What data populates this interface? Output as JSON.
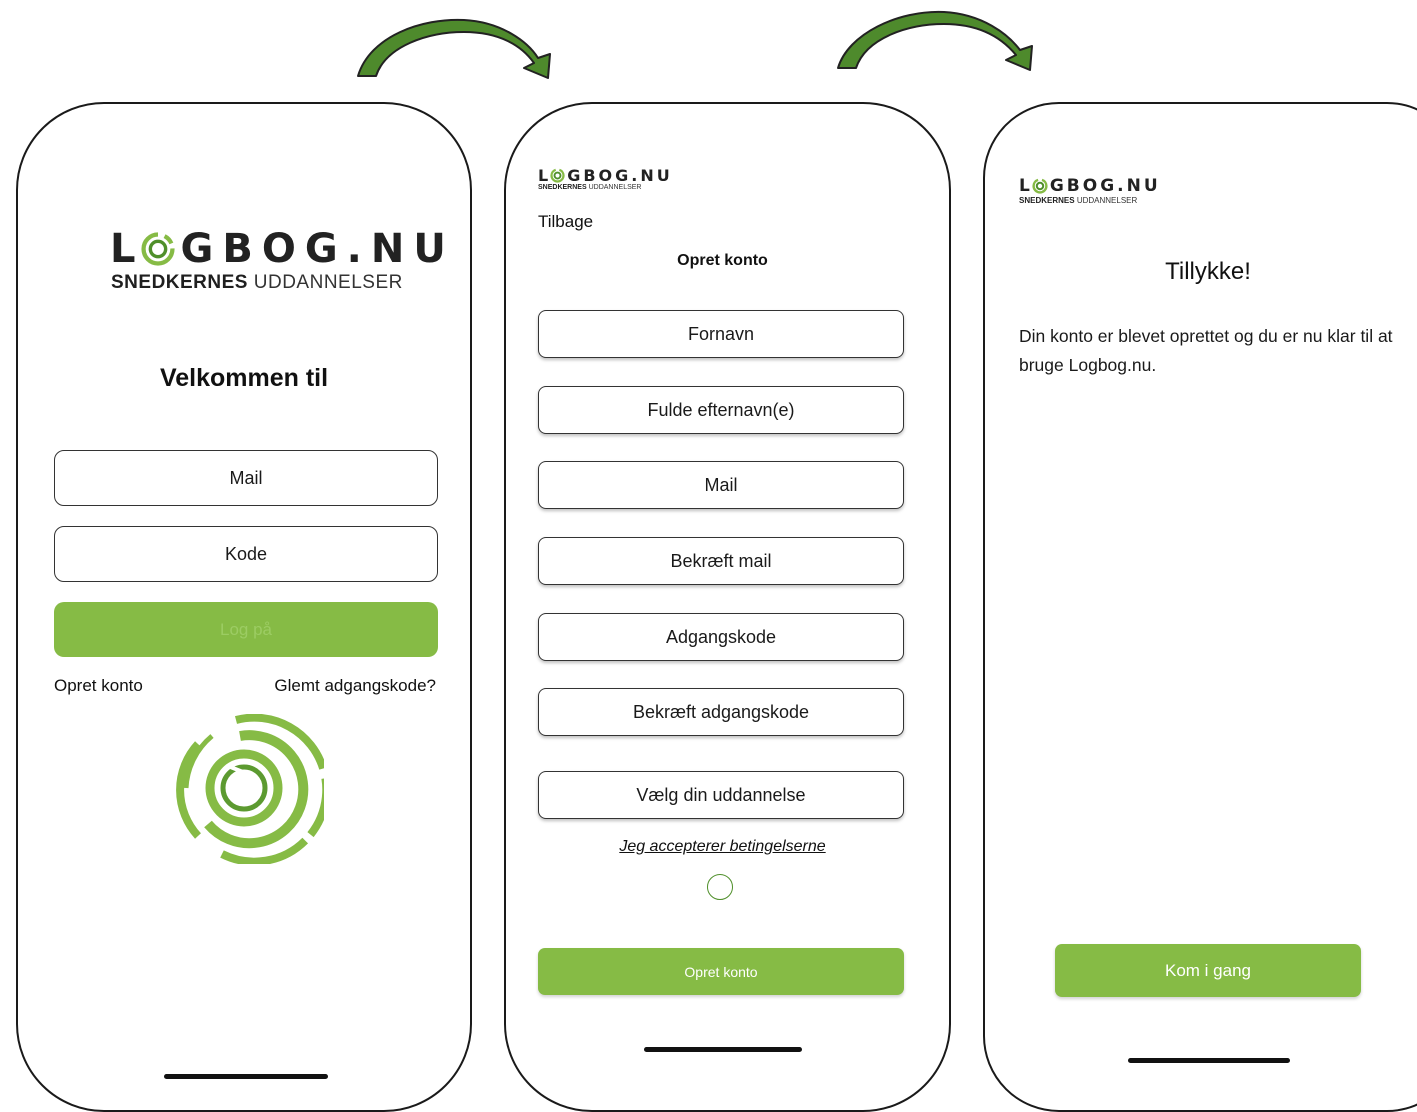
{
  "brand": {
    "wordmark_left": "L",
    "wordmark_right": "GBOG.NU",
    "subtitle_bold": "SNEDKERNES",
    "subtitle_light": "UDDANNELSER",
    "green": "#86bb45"
  },
  "login_screen": {
    "welcome": "Velkommen til",
    "mail_placeholder": "Mail",
    "code_placeholder": "Kode",
    "login_button": "Log på",
    "create_account_link": "Opret konto",
    "forgot_password_link": "Glemt adgangskode?"
  },
  "signup_screen": {
    "back_link": "Tilbage",
    "heading": "Opret konto",
    "fields": {
      "first_name": "Fornavn",
      "last_name": "Fulde efternavn(e)",
      "mail": "Mail",
      "confirm_mail": "Bekræft mail",
      "password": "Adgangskode",
      "confirm_password": "Bekræft adgangskode",
      "education_select": "Vælg din uddannelse"
    },
    "terms_link": "Jeg accepterer betingelserne",
    "submit_button": "Opret konto"
  },
  "success_screen": {
    "heading": "Tillykke!",
    "message": "Din konto er blevet oprettet og du er nu klar til at bruge Logbog.nu.",
    "start_button": "Kom i gang"
  },
  "icons": {
    "flow_arrow": "curved-arrow-right",
    "logo_mark": "target-ring-logo",
    "terms_checkbox": "radio-circle"
  }
}
